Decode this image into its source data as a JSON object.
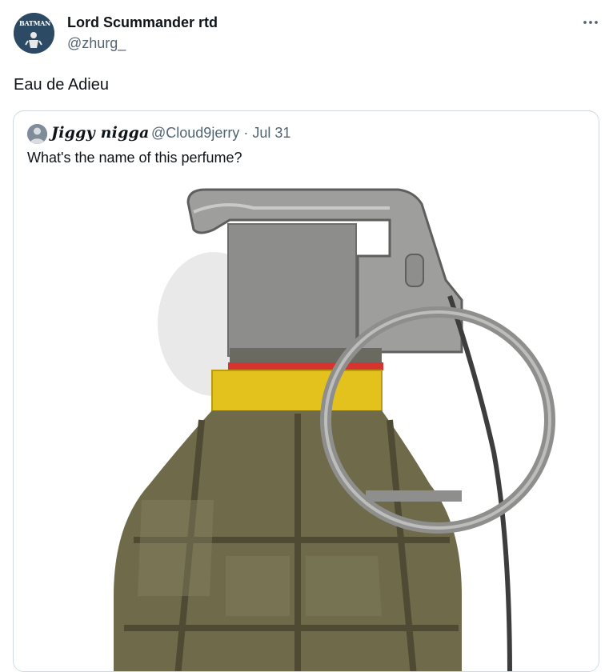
{
  "tweet": {
    "author": {
      "display_name": "Lord Scummander rtd",
      "handle": "@zhurg_",
      "avatar_text": "BATMAN",
      "avatar_icon": "batman-avatar"
    },
    "text": "Eau de Adieu",
    "more_icon": "more-horizontal-icon"
  },
  "quote": {
    "author": {
      "display_name": "Jiggy nigga",
      "handle": "@Cloud9jerry",
      "separator": "·",
      "date": "Jul 31",
      "avatar_icon": "user-avatar"
    },
    "text": "What's the name of this perfume?",
    "image": {
      "subject": "hand grenade photo",
      "colors": {
        "body": "#6e6a4a",
        "lever": "#9a9a98",
        "band_yellow": "#e4c21e",
        "band_red": "#d6342e",
        "ring": "#8e8e8c"
      }
    }
  },
  "theme": {
    "text_primary": "#0f1419",
    "text_secondary": "#536471",
    "border": "#cfd9de"
  }
}
